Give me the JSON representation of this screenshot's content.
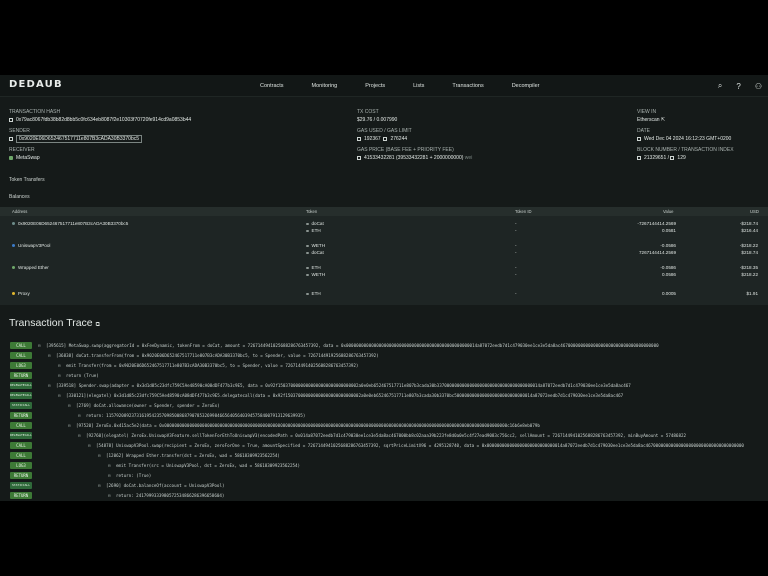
{
  "nav": {
    "logo": "DEDAUB",
    "links": [
      "Contracts",
      "Monitoring",
      "Projects",
      "Lists",
      "Transactions",
      "Decompiler"
    ],
    "icons": [
      "search-icon",
      "help-icon",
      "user-icon"
    ]
  },
  "tx": {
    "hash_label": "TRANSACTION HASH",
    "hash": "0x79ac8067fdb38b82d8bb5c0fc634eb8087f2e10303f70720fe914cd9a0853b44",
    "sender_label": "SENDER",
    "sender": "0x9020E06D652467517711e807B3cADA30B3370bc5",
    "receiver_label": "RECEIVER",
    "receiver": "MetaSwap",
    "cost_label": "TX COST",
    "cost": "$29.76 / 0.007990",
    "gas_label": "GAS USED / GAS LIMIT",
    "gas_used": "192367",
    "gas_limit": "276244",
    "gasprice_label": "GAS PRICE (BASE FEE + PRIORITY FEE)",
    "gasprice": "41533432281 (39533432281 + 2000000000)",
    "gasprice_unit": "wei",
    "viewin_label": "VIEW IN",
    "viewin": "Etherscan",
    "date_label": "DATE",
    "date": "Wed Dec 04 2024 16:12:23 GMT+0200",
    "block_label": "BLOCK NUMBER / TRANSACTION INDEX",
    "block": "21329651",
    "index": "129"
  },
  "token_transfers": "Token Transfers",
  "balances": {
    "title": "Balances",
    "headers": [
      "Address",
      "Token",
      "Token ID",
      "Value",
      "USD"
    ],
    "rows": [
      {
        "address": "0x9020E06D652467517711e807B3cADA30B3370bc5",
        "tokens": [
          "doCat",
          "ETH"
        ],
        "ids": [
          "-",
          "-"
        ],
        "values": [
          "-7267144414.2569",
          "0.0581"
        ],
        "usd": [
          "-$218.74",
          "$216.44"
        ]
      },
      {
        "address": "UniswapV3Pool",
        "tokens": [
          "WETH",
          "doCat"
        ],
        "ids": [
          "-",
          "-"
        ],
        "values": [
          "-0.0586",
          "7267144414.2569"
        ],
        "usd": [
          "-$218.22",
          "$218.74"
        ]
      },
      {
        "address": "Wrapped Ether",
        "tokens": [
          "ETH",
          "WETH"
        ],
        "ids": [
          "-",
          "-"
        ],
        "values": [
          "-0.0586",
          "0.0586"
        ],
        "usd": [
          "-$218.35",
          "$218.22"
        ]
      },
      {
        "address": "Proxy",
        "tokens": [
          "ETH"
        ],
        "ids": [
          "-"
        ],
        "values": [
          "0.0005"
        ],
        "usd": [
          "$1.91"
        ]
      }
    ]
  },
  "trace": {
    "title": "Transaction Trace",
    "rows": [
      {
        "tag": "CALL",
        "indent": 0,
        "text": "[395615] MetaSwap.swap(aggregatorId = 0xFeeDynamic, tokenFrom = doCat, amount = 7267144941025688286763457392, data = 0x0000000000000000000000000000000000000000000000000014a87072eedb7d1c479030ee1ce3e5da8ac467000000000000000000000000000000000000"
      },
      {
        "tag": "CALL",
        "indent": 1,
        "text": "[36838] doCat.transferFrom(from = 0x9020E06D652467517711e807B3cADA30B3370bc5, to = Spender, value = 726714491925688286763457392)"
      },
      {
        "tag": "LOG3",
        "indent": 2,
        "text": "emit Transfer(from = 0x9020E06D652467517711e807B3cADA30B3370bc5, to = Spender, value = 7267144914025688286763457392)"
      },
      {
        "tag": "RETURN",
        "indent": 2,
        "text": "return (True)"
      },
      {
        "tag": "DELEGATECALL",
        "indent": 1,
        "text": "[339518] Spender.swap(adapter = 0x3d1d85c23dfc759C5Ae48590cA08dDF477b3c9E5, data = 0x92f15037000000000000000000000000002a0e0eb652467517711e807b3cada30b33700000000000000000000000000000000000014a87072eedb7d1c479030ee1ce3e5da8ac467"
      },
      {
        "tag": "DELEGATECALL",
        "indent": 2,
        "text": "[330121](elegatel) 0x3d1d85c23dfc759C5Ae48590cA08dDF477b3c9E5.delegatecall(data = 0x92f150370000000000000000000000002a0e0eb652467517711e807b3cada30b3370bc5000000000000000000000000000014a87072eedb7d1c479030ee1ce3e5da8ac467"
      },
      {
        "tag": "STATICCALL",
        "indent": 3,
        "text": "[2769] doCat.allowance(owner = Spender, spender = ZeroEx)"
      },
      {
        "tag": "RETURN",
        "indent": 4,
        "text": "return: 115792089237316195423570985008687907853269984665640564039457584007913129639935)"
      },
      {
        "tag": "CALL",
        "indent": 3,
        "text": "[97520] ZeroEx.0x415ac5e2(data = 0x0000000000000000000000000000000000000000000000000000000000000000000000000000000000000000000000000000000000000000000000000000000000000000c16b6e8eb079b"
      },
      {
        "tag": "DELEGATECALL",
        "indent": 4,
        "text": "[92760](elegatel) ZeroEx.UniswapV3Feature.sellTokenForEthToUniswapV3(encodedPath = 0x014a87072eedb7d1c479030ee1ce3e5da8ac467000bb8c02aaa39b223fe8d0a0e5c4f27ead9083c756cc2, sellAmount = 7267144941025688286763457392, minBuyAmount = 57486822"
      },
      {
        "tag": "CALL",
        "indent": 5,
        "text": "[54878] UniswapV3Pool.swap(recipient = ZeroEx, zeroForOne = True, amountSpecified = 7267144941025688286763457392, sqrtPriceLimitX96 = 4295128740, data = 0x000000000000000000000000000014a87072eedb7d1c479030ee1ce3e5da8ac467000000000000000000000000000000000000"
      },
      {
        "tag": "CALL",
        "indent": 6,
        "text": "[12062] Wrapped Ether.transfer(dst = ZeroEx, wad = 58618309923562254)"
      },
      {
        "tag": "LOG3",
        "indent": 7,
        "text": "emit Transfer(src = UniswapV3Pool, dst = ZeroEx, wad = 58618309923562254)"
      },
      {
        "tag": "RETURN",
        "indent": 7,
        "text": "return: (True)"
      },
      {
        "tag": "STATICCALL",
        "indent": 6,
        "text": "[2690] doCat.balanceOf(account = UniswapV3Pool)"
      },
      {
        "tag": "RETURN",
        "indent": 7,
        "text": "return: 2417999333980572534866286396658604)"
      }
    ]
  }
}
